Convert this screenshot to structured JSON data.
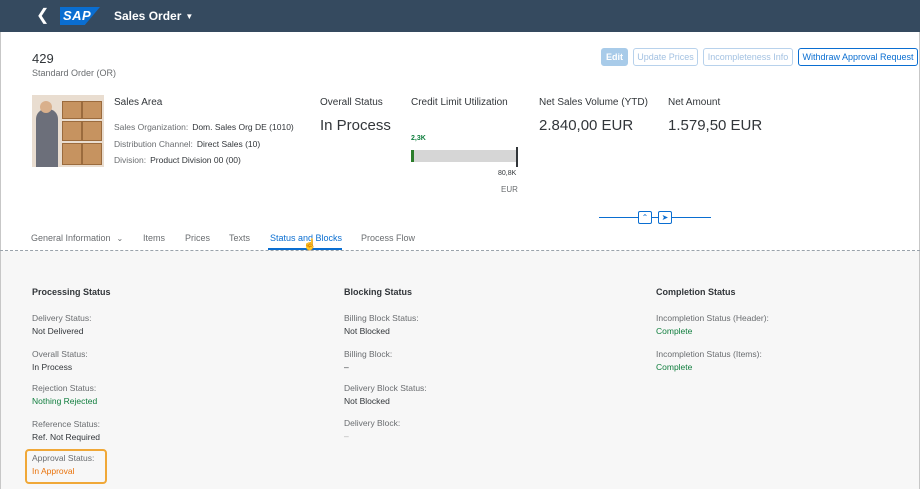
{
  "shell": {
    "back_icon": "chevron-left-icon",
    "logo": "SAP",
    "app_title": "Sales Order"
  },
  "header": {
    "object_id": "429",
    "object_type": "Standard Order (OR)",
    "buttons": {
      "edit": "Edit",
      "update_prices": "Update Prices",
      "incompleteness_info": "Incompleteness Info",
      "withdraw": "Withdraw Approval Request"
    },
    "sales_area": {
      "title": "Sales Area",
      "org_label": "Sales Organization:",
      "org_value": "Dom. Sales Org DE (1010)",
      "channel_label": "Distribution Channel:",
      "channel_value": "Direct Sales (10)",
      "division_label": "Division:",
      "division_value": "Product Division 00 (00)"
    },
    "overall_status": {
      "label": "Overall Status",
      "value": "In Process"
    },
    "credit_limit": {
      "label": "Credit Limit Utilization",
      "used_label": "2,3K",
      "max_label": "80,8K",
      "unit": "EUR",
      "used": 2.3,
      "max": 80.8,
      "fill_color": "#2b7d2b"
    },
    "net_sales": {
      "label": "Net Sales Volume (YTD)",
      "value": "2.840,00 EUR"
    },
    "net_amount": {
      "label": "Net Amount",
      "value": "1.579,50 EUR"
    }
  },
  "tabs": [
    {
      "label": "General Information"
    },
    {
      "label": "Items"
    },
    {
      "label": "Prices"
    },
    {
      "label": "Texts"
    },
    {
      "label": "Status and Blocks"
    },
    {
      "label": "Process Flow"
    }
  ],
  "active_tab": "Status and Blocks",
  "processing": {
    "title": "Processing Status",
    "delivery_label": "Delivery Status:",
    "delivery_value": "Not Delivered",
    "overall_label": "Overall Status:",
    "overall_value": "In Process",
    "rejection_label": "Rejection Status:",
    "rejection_value": "Nothing Rejected",
    "reference_label": "Reference Status:",
    "reference_value": "Ref. Not Required",
    "approval_label": "Approval Status:",
    "approval_value": "In Approval"
  },
  "blocking": {
    "title": "Blocking Status",
    "billing_status_label": "Billing Block Status:",
    "billing_status_value": "Not Blocked",
    "billing_block_label": "Billing Block:",
    "billing_block_value": "–",
    "delivery_status_label": "Delivery Block Status:",
    "delivery_status_value": "Not Blocked",
    "delivery_block_label": "Delivery Block:",
    "delivery_block_value": "–"
  },
  "completion": {
    "title": "Completion Status",
    "header_label": "Incompletion Status (Header):",
    "header_value": "Complete",
    "items_label": "Incompletion Status (Items):",
    "items_value": "Complete"
  },
  "colors": {
    "shell": "#354a5f",
    "brand": "#0a6ed1",
    "positive": "#107e3e",
    "warning": "#e9730c",
    "highlight": "#f0a838"
  }
}
